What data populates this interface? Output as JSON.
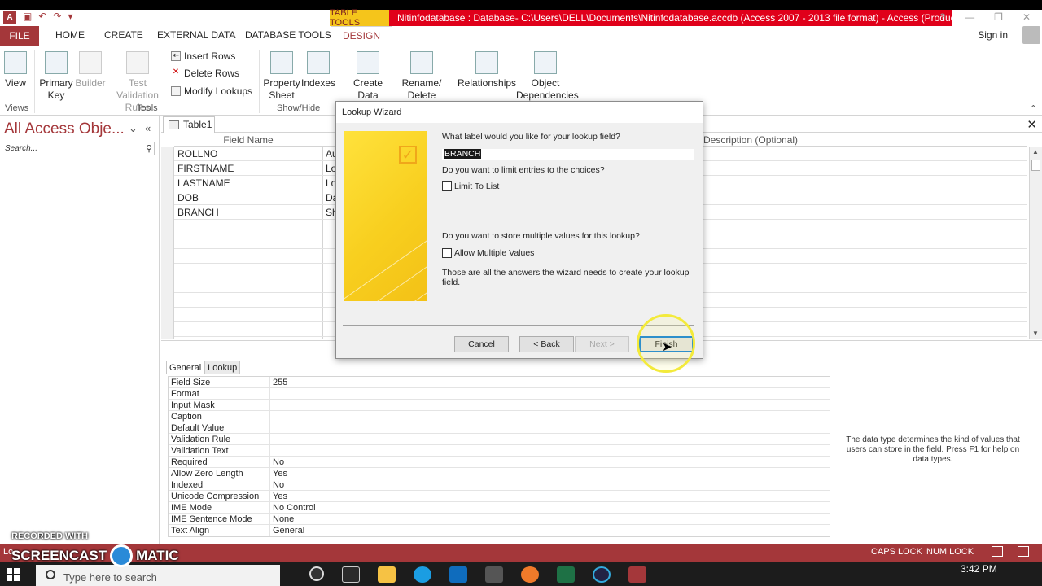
{
  "window": {
    "qat_logo": "A",
    "context_tab": "TABLE TOOLS",
    "title": "Nitinfodatabase : Database- C:\\Users\\DELL\\Documents\\Nitinfodatabase.accdb (Access 2007 - 2013 file format) -  Access (Product Acti...",
    "help_btn": "?",
    "min_btn": "—",
    "max_btn": "❐",
    "close_btn": "✕"
  },
  "ribbon_tabs": {
    "file": "FILE",
    "home": "HOME",
    "create": "CREATE",
    "external_data": "EXTERNAL DATA",
    "database_tools": "DATABASE TOOLS",
    "design": "DESIGN",
    "sign_in": "Sign in"
  },
  "ribbon": {
    "view": "View",
    "primary_key": "Primary Key",
    "builder": "Builder",
    "test_validation_rules": "Test Validation Rules",
    "insert_rows": "Insert Rows",
    "delete_rows": "Delete Rows",
    "modify_lookups": "Modify Lookups",
    "property_sheet": "Property Sheet",
    "indexes": "Indexes",
    "create_data_macros": "Create Data Macros",
    "rename_delete_macro": "Rename/ Delete Macro",
    "relationships": "Relationships",
    "object_dependencies": "Object Dependencies",
    "group_views": "Views",
    "group_tools": "Tools",
    "group_show_hide": "Show/Hide"
  },
  "nav": {
    "title": "All Access Obje...",
    "search_placeholder": "Search...",
    "dropdown_icon": "⌄",
    "collapse_icon": "«"
  },
  "doc": {
    "tab_label": "Table1",
    "close": "✕"
  },
  "grid": {
    "col_field_name": "Field Name",
    "col_data_type": "Data Type",
    "col_description": "Description (Optional)",
    "rows": [
      {
        "name": "ROLLNO",
        "type": "Au"
      },
      {
        "name": "FIRSTNAME",
        "type": "Lo"
      },
      {
        "name": "LASTNAME",
        "type": "Lo"
      },
      {
        "name": "DOB",
        "type": "Da"
      },
      {
        "name": "BRANCH",
        "type": "Sh"
      }
    ]
  },
  "props": {
    "tab_general": "General",
    "tab_lookup": "Lookup",
    "rows": [
      {
        "label": "Field Size",
        "value": "255"
      },
      {
        "label": "Format",
        "value": ""
      },
      {
        "label": "Input Mask",
        "value": ""
      },
      {
        "label": "Caption",
        "value": ""
      },
      {
        "label": "Default Value",
        "value": ""
      },
      {
        "label": "Validation Rule",
        "value": ""
      },
      {
        "label": "Validation Text",
        "value": ""
      },
      {
        "label": "Required",
        "value": "No"
      },
      {
        "label": "Allow Zero Length",
        "value": "Yes"
      },
      {
        "label": "Indexed",
        "value": "No"
      },
      {
        "label": "Unicode Compression",
        "value": "Yes"
      },
      {
        "label": "IME Mode",
        "value": "No Control"
      },
      {
        "label": "IME Sentence Mode",
        "value": "None"
      },
      {
        "label": "Text Align",
        "value": "General"
      }
    ],
    "help": "The data type determines the kind of values that users can store in the field. Press F1 for help on data types."
  },
  "dialog": {
    "title": "Lookup Wizard",
    "q_label": "What label would you like for your lookup field?",
    "label_value": "BRANCH",
    "q_limit": "Do you want to limit entries to the choices?",
    "limit_to_list": "Limit To List",
    "q_multiple": "Do you want to store multiple values for this lookup?",
    "allow_multiple": "Allow Multiple Values",
    "answers_note": "Those are all the answers the wizard needs to create your lookup field.",
    "cancel": "Cancel",
    "back": "< Back",
    "next": "Next >",
    "finish": "Finish"
  },
  "status": {
    "left": "Lo",
    "caps_lock": "CAPS LOCK",
    "num_lock": "NUM LOCK"
  },
  "taskbar": {
    "search_placeholder": "Type here to search",
    "time": "3:42 PM"
  },
  "watermark": {
    "line1": "RECORDED WITH",
    "line2a": "SCREENCAST",
    "line2b": "MATIC"
  },
  "colors": {
    "accent": "#a4373a",
    "title_red": "#e0001a",
    "context_tab_yellow": "#f5c51b"
  }
}
